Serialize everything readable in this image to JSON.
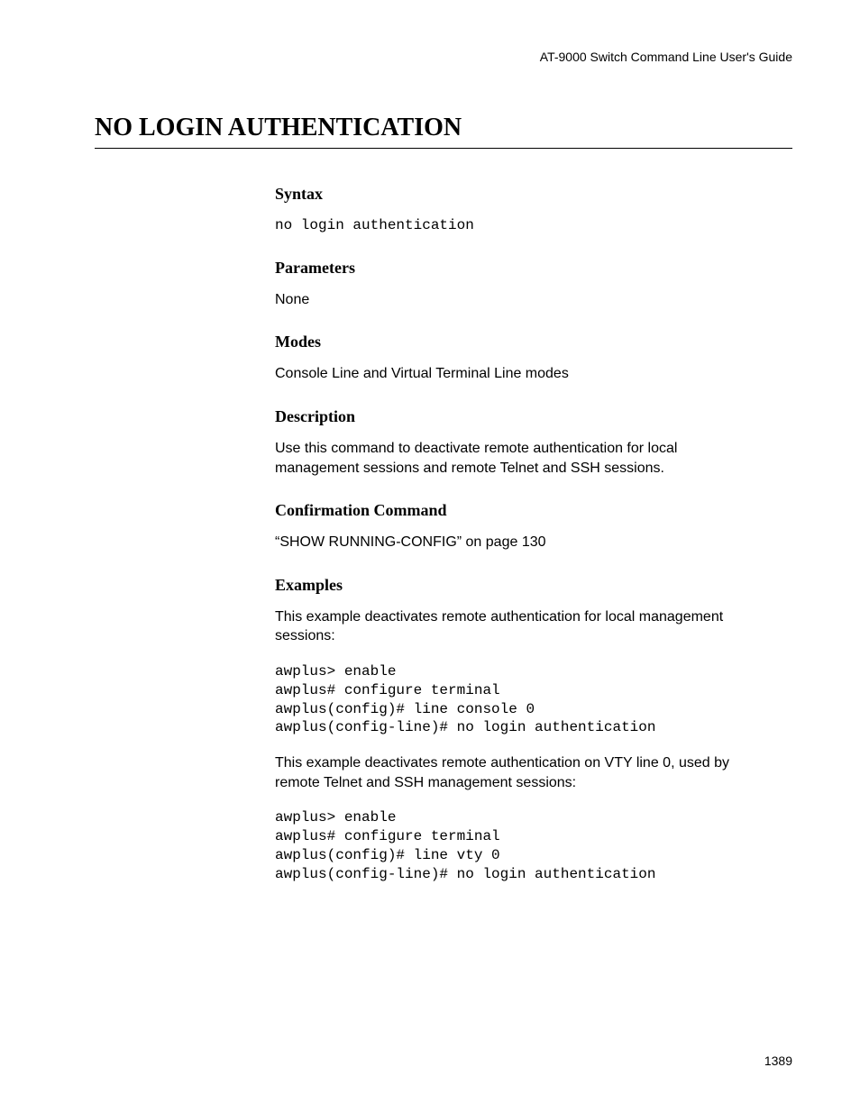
{
  "header": {
    "guide": "AT-9000 Switch Command Line User's Guide"
  },
  "title": "NO LOGIN AUTHENTICATION",
  "sections": {
    "syntax": {
      "heading": "Syntax",
      "command": "no login authentication"
    },
    "parameters": {
      "heading": "Parameters",
      "text": "None"
    },
    "modes": {
      "heading": "Modes",
      "text": "Console Line and Virtual Terminal Line modes"
    },
    "description": {
      "heading": "Description",
      "text": "Use this command to deactivate remote authentication for local management sessions and remote Telnet and SSH sessions."
    },
    "confirmation": {
      "heading": "Confirmation Command",
      "text": "“SHOW RUNNING-CONFIG” on page 130"
    },
    "examples": {
      "heading": "Examples",
      "intro1": "This example deactivates remote authentication for local management sessions:",
      "code1": "awplus> enable\nawplus# configure terminal\nawplus(config)# line console 0\nawplus(config-line)# no login authentication",
      "intro2": "This example deactivates remote authentication on VTY line 0, used by remote Telnet and SSH management sessions:",
      "code2": "awplus> enable\nawplus# configure terminal\nawplus(config)# line vty 0\nawplus(config-line)# no login authentication"
    }
  },
  "pageNumber": "1389"
}
